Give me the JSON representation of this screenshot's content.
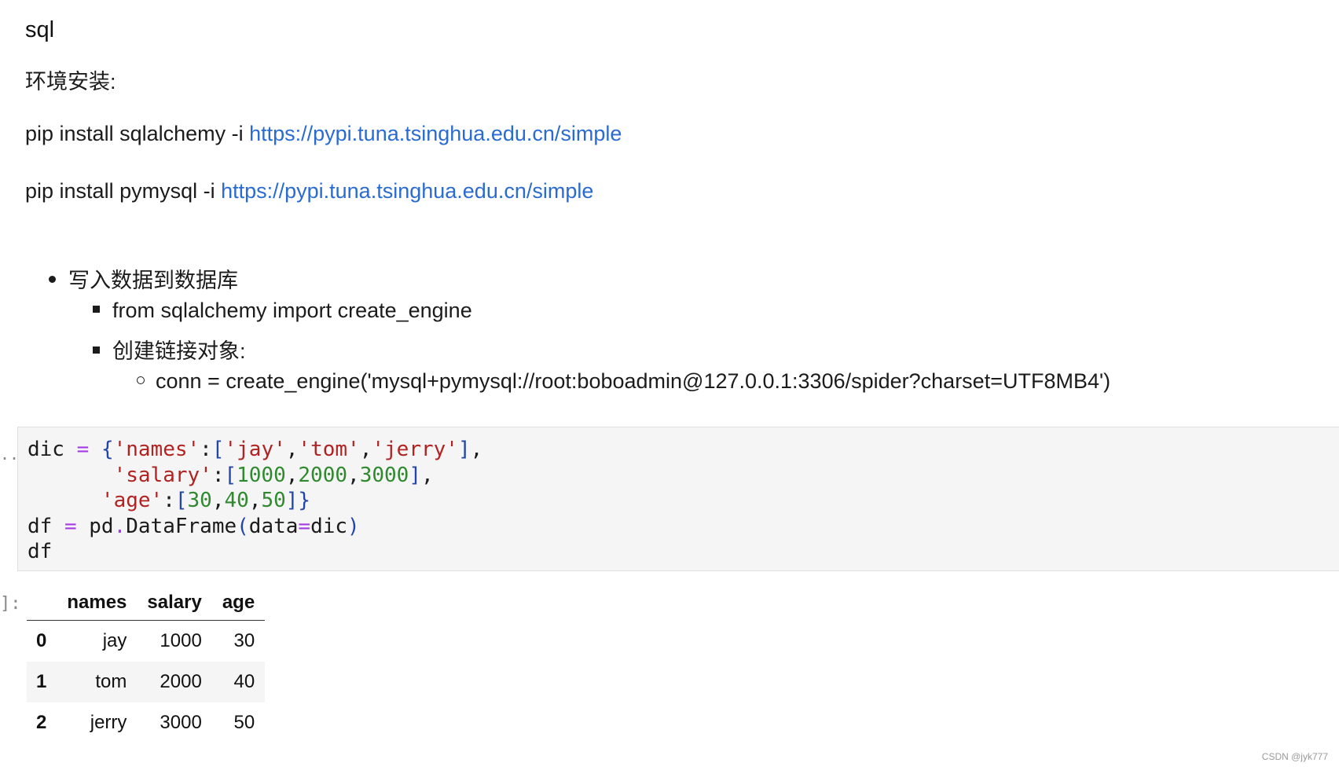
{
  "markdown": {
    "heading": "sql",
    "env_label": "环境安装:",
    "pip1_prefix": "pip install sqlalchemy -i ",
    "pip1_link": "https://pypi.tuna.tsinghua.edu.cn/simple",
    "pip2_prefix": "pip install pymysql -i ",
    "pip2_link": "https://pypi.tuna.tsinghua.edu.cn/simple",
    "bullet1": "写入数据到数据库",
    "sub1": "from sqlalchemy import create_engine",
    "sub2": "创建链接对象:",
    "subsub1": "conn = create_engine('mysql+pymysql://root:boboadmin@127.0.0.1:3306/spider?charset=UTF8MB4')"
  },
  "code_cell": {
    "prompt": "..",
    "lines": [
      "dic = {'names':['jay','tom','jerry'],",
      "       'salary':[1000,2000,3000],",
      "      'age':[30,40,50]}",
      "df = pd.DataFrame(data=dic)",
      "df"
    ]
  },
  "output": {
    "prompt": "]:",
    "columns": [
      "",
      "names",
      "salary",
      "age"
    ],
    "rows": [
      {
        "index": "0",
        "names": "jay",
        "salary": "1000",
        "age": "30"
      },
      {
        "index": "1",
        "names": "tom",
        "salary": "2000",
        "age": "40"
      },
      {
        "index": "2",
        "names": "jerry",
        "salary": "3000",
        "age": "50"
      }
    ]
  },
  "watermark": "CSDN @jyk777",
  "colors": {
    "link": "#2a6bd1",
    "operator": "#a63ae6",
    "string": "#b22222",
    "number": "#2f8a2f",
    "bracket": "#2146a8",
    "cell_bg": "#f5f5f5"
  }
}
